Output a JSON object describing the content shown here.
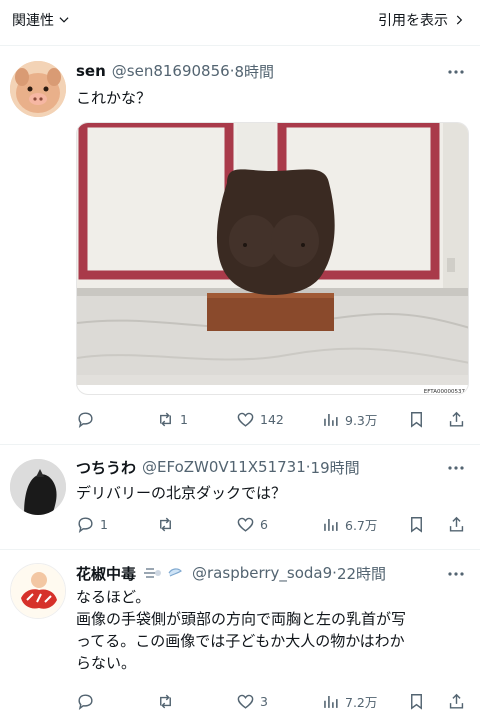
{
  "topbar": {
    "sort_label": "関連性",
    "quotes_label": "引用を表示"
  },
  "tweets": [
    {
      "name": "sen",
      "handle": "@sen81690856",
      "time": "8時間",
      "text": "これかな？",
      "image_caption": "EFTA00000537",
      "stats": {
        "replies": "",
        "reposts": "1",
        "likes": "142",
        "views": "9.3万"
      }
    },
    {
      "name": "つちうわ",
      "handle": "@EFoZW0V11X51731",
      "time": "19時間",
      "text": "デリバリーの北京ダックでは？",
      "stats": {
        "replies": "1",
        "reposts": "",
        "likes": "6",
        "views": "6.7万"
      }
    },
    {
      "name": "花椒中毒",
      "handle": "@raspberry_soda9",
      "time": "22時間",
      "text_lines": [
        "なるほど。",
        "画像の手袋側が頭部の方向で両胸と左の乳首が写",
        "ってる。この画像では子どもか大人の物かはわか",
        "らない。"
      ],
      "stats": {
        "replies": "",
        "reposts": "",
        "likes": "3",
        "views": "7.2万"
      }
    }
  ],
  "icons": [
    "chevron-down-icon",
    "chevron-right-icon",
    "more-icon",
    "reply-icon",
    "repost-icon",
    "like-icon",
    "views-icon",
    "bookmark-icon",
    "share-icon"
  ],
  "colors": {
    "text": "#0f1419",
    "secondary": "#536471",
    "divider": "#eff3f4"
  }
}
